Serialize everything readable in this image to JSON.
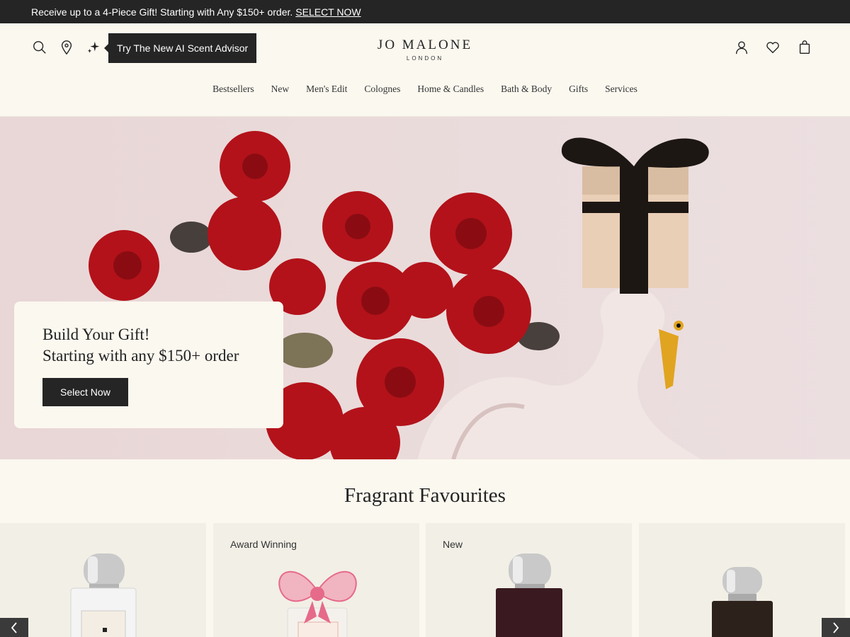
{
  "promo": {
    "text": "Receive up to a 4-Piece Gift! Starting with Any $150+ order.",
    "link": "SELECT NOW"
  },
  "header": {
    "tooltip": "Try The New AI Scent Advisor",
    "logo_main": "JO MALONE",
    "logo_sub": "LONDON",
    "icons": [
      "search-icon",
      "location-icon",
      "sparkle-icon",
      "account-icon",
      "wishlist-icon",
      "bag-icon"
    ]
  },
  "nav": [
    "Bestsellers",
    "New",
    "Men's Edit",
    "Colognes",
    "Home & Candles",
    "Bath & Body",
    "Gifts",
    "Services"
  ],
  "hero": {
    "line1": "Build Your Gift!",
    "line2": "Starting with any $150+ order",
    "cta": "Select Now"
  },
  "section_title": "Fragrant Favourites",
  "products": [
    {
      "badge": ""
    },
    {
      "badge": "Award Winning"
    },
    {
      "badge": "New"
    },
    {
      "badge": ""
    }
  ],
  "colors": {
    "background": "#fbf8ef",
    "dark": "#252525",
    "rose": "#b3121a"
  }
}
